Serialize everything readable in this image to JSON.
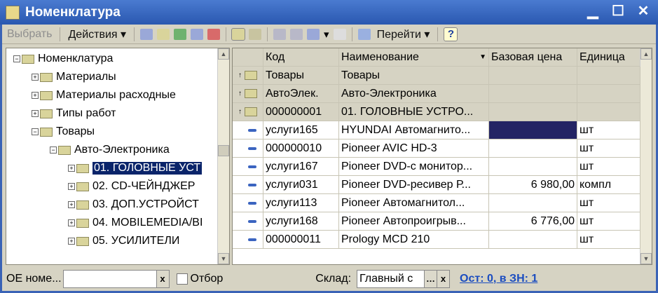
{
  "window": {
    "title": "Номенклатура"
  },
  "toolbar": {
    "select": "Выбрать",
    "actions": "Действия",
    "goto": "Перейти",
    "help": "?"
  },
  "tree": [
    {
      "label": "Номенклатура",
      "level": 0,
      "exp": "−"
    },
    {
      "label": "Материалы",
      "level": 1,
      "exp": "+"
    },
    {
      "label": "Материалы расходные",
      "level": 1,
      "exp": "+"
    },
    {
      "label": "Типы работ",
      "level": 1,
      "exp": "+"
    },
    {
      "label": "Товары",
      "level": 1,
      "exp": "−"
    },
    {
      "label": "Авто-Электроника",
      "level": 2,
      "exp": "−"
    },
    {
      "label": "01. ГОЛОВНЫЕ УСТ",
      "level": 3,
      "exp": "+",
      "selected": true
    },
    {
      "label": "02. CD-ЧЕЙНДЖЕР",
      "level": 3,
      "exp": "+"
    },
    {
      "label": "03. ДОП.УСТРОЙСТ",
      "level": 3,
      "exp": "+"
    },
    {
      "label": "04. MOBILEMEDIA/ВI",
      "level": 3,
      "exp": "+"
    },
    {
      "label": "05. УСИЛИТЕЛИ",
      "level": 3,
      "exp": "+"
    }
  ],
  "table": {
    "columns": [
      "Код",
      "Наименование",
      "Базовая цена",
      "Единица"
    ],
    "rows": [
      {
        "type": "group",
        "code": "Товары",
        "name": "Товары",
        "price": "",
        "unit": ""
      },
      {
        "type": "group",
        "code": "АвтоЭлек.",
        "name": "Авто-Электроника",
        "price": "",
        "unit": ""
      },
      {
        "type": "group",
        "code": "000000001",
        "name": "01. ГОЛОВНЫЕ УСТРО...",
        "price": "",
        "unit": ""
      },
      {
        "type": "item",
        "code": "услуги165",
        "name": "HYUNDAI Автомагнито...",
        "price": "",
        "unit": "шт",
        "current": true
      },
      {
        "type": "item",
        "code": "000000010",
        "name": "Pioneer AVIC HD-3",
        "price": "",
        "unit": "шт"
      },
      {
        "type": "item",
        "code": "услуги167",
        "name": "Pioneer DVD-с монитор...",
        "price": "",
        "unit": "шт"
      },
      {
        "type": "item",
        "code": "услуги031",
        "name": "Pioneer DVD-ресивер Р...",
        "price": "6 980,00",
        "unit": "компл"
      },
      {
        "type": "item",
        "code": "услуги113",
        "name": "Pioneer Автомагнитол...",
        "price": "",
        "unit": "шт"
      },
      {
        "type": "item",
        "code": "услуги168",
        "name": "Pioneer Автопроигрыв...",
        "price": "6 776,00",
        "unit": "шт"
      },
      {
        "type": "item",
        "code": "000000011",
        "name": "Prology MCD 210",
        "price": "",
        "unit": "шт"
      }
    ]
  },
  "status": {
    "oe_label": "ОЕ номе...",
    "oe_value": "",
    "filter": "Отбор",
    "warehouse_label": "Склад:",
    "warehouse_value": "Главный с",
    "link": "Ост: 0, в ЗН: 1"
  }
}
